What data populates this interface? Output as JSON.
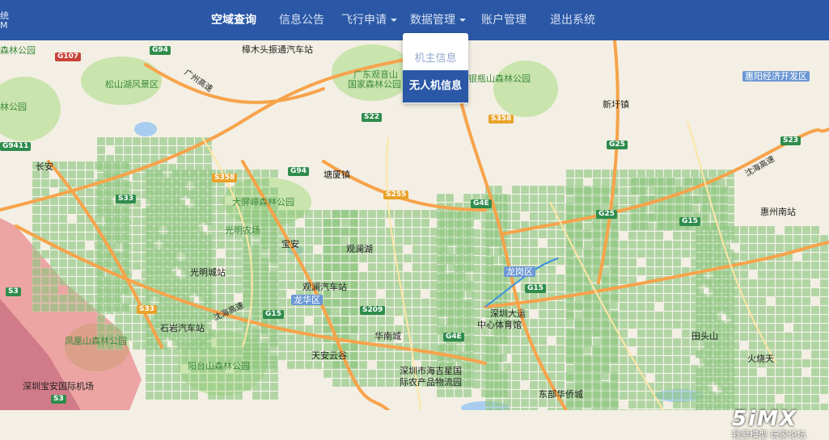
{
  "brand": {
    "line1": "统",
    "line2": "M"
  },
  "nav": {
    "items": [
      {
        "label": "空域查询",
        "active": true
      },
      {
        "label": "信息公告"
      },
      {
        "label": "飞行申请"
      },
      {
        "label": "数据管理"
      },
      {
        "label": "账户管理"
      },
      {
        "label": "退出系统"
      }
    ]
  },
  "dropdown": {
    "items": [
      {
        "label": "机主信息"
      },
      {
        "label": "无人机信息"
      }
    ]
  },
  "map": {
    "colors": {
      "land": "#f3efe4",
      "grid": "#8cc47e",
      "restricted": "#e8686e",
      "water": "#a8cdf0",
      "park": "#c9e4ad",
      "road": "#f7a34b"
    },
    "labels": [
      "森林公园",
      "樟木头振通汽车站",
      "广东观音山",
      "国家森林公园",
      "银瓶山森林公园",
      "惠阳经济开发区",
      "松山湖风景区",
      "林公园",
      "新圩镇",
      "大屏嶂森林公园",
      "惠州南站",
      "光明农场",
      "宝安",
      "观澜湖",
      "光明城站",
      "观澜汽车站",
      "龙华区",
      "龙岗区",
      "深圳大运",
      "中心体育馆",
      "石岩汽车站",
      "凤凰山森林公园",
      "华南城",
      "阳台山森林公园",
      "田头山",
      "天安云谷",
      "火烧天",
      "深圳宝安国际机场",
      "深圳市海吉星国",
      "际农产品物流园",
      "东部华侨城",
      "长安",
      "塘厦镇"
    ],
    "shields": [
      "G107",
      "G94",
      "S22",
      "S358",
      "G9411",
      "S358",
      "G94",
      "S255",
      "G4E",
      "G25",
      "S23",
      "G15",
      "G25",
      "S33",
      "S3",
      "S33",
      "G15",
      "S209",
      "G4E",
      "G15",
      "S3"
    ],
    "roads": [
      "广州高速",
      "沈海高速",
      "沈海高速"
    ]
  },
  "watermark": {
    "logo": "5iMX",
    "slogan": "我爱模型 玩家论坛"
  }
}
